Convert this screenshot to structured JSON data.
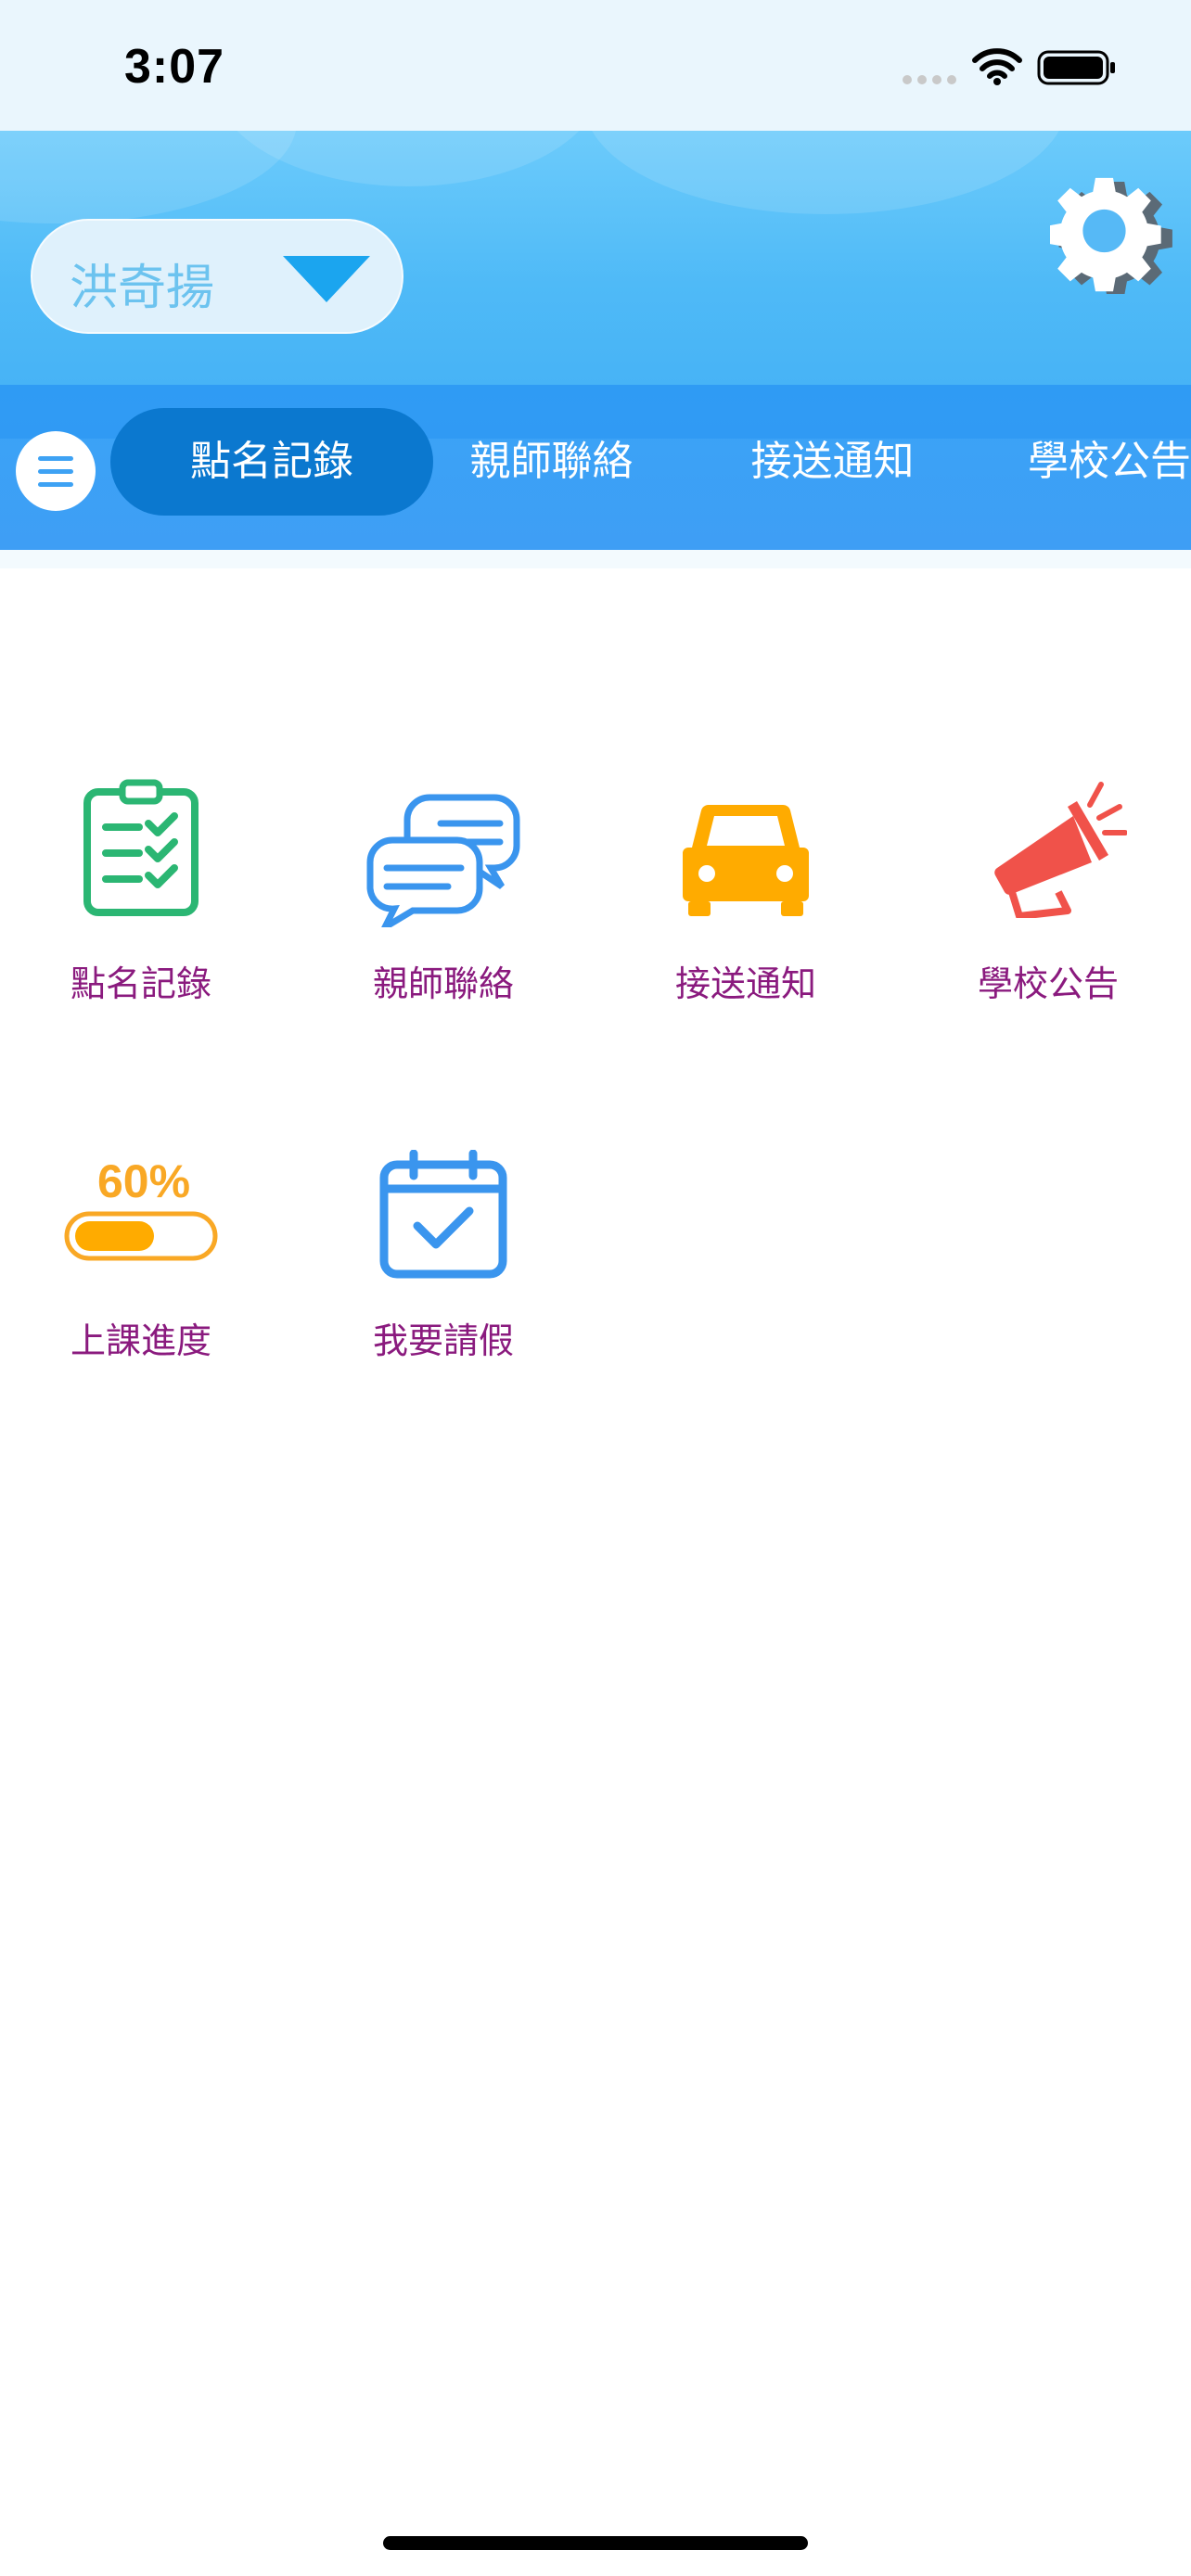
{
  "status_bar": {
    "time": "3:07"
  },
  "header": {
    "student_name": "洪奇揚"
  },
  "tabs": [
    {
      "label": "點名記錄",
      "active": true
    },
    {
      "label": "親師聯絡",
      "active": false
    },
    {
      "label": "接送通知",
      "active": false
    },
    {
      "label": "學校公告",
      "active": false
    }
  ],
  "features": [
    {
      "label": "點名記錄",
      "icon": "attendance-clipboard-icon",
      "color": "#2bb673"
    },
    {
      "label": "親師聯絡",
      "icon": "chat-bubbles-icon",
      "color": "#3a95ee"
    },
    {
      "label": "接送通知",
      "icon": "car-icon",
      "color": "#ffab00"
    },
    {
      "label": "學校公告",
      "icon": "megaphone-icon",
      "color": "#f0524a"
    },
    {
      "label": "上課進度",
      "icon": "progress-bar-icon",
      "color": "#f9a825",
      "progress_text": "60%",
      "progress": 0.6
    },
    {
      "label": "我要請假",
      "icon": "calendar-check-icon",
      "color": "#3a95ee"
    }
  ],
  "colors": {
    "header_blue": "#4fbaf7",
    "tab_active": "#0b78cf",
    "label_purple": "#8a1a7e"
  }
}
